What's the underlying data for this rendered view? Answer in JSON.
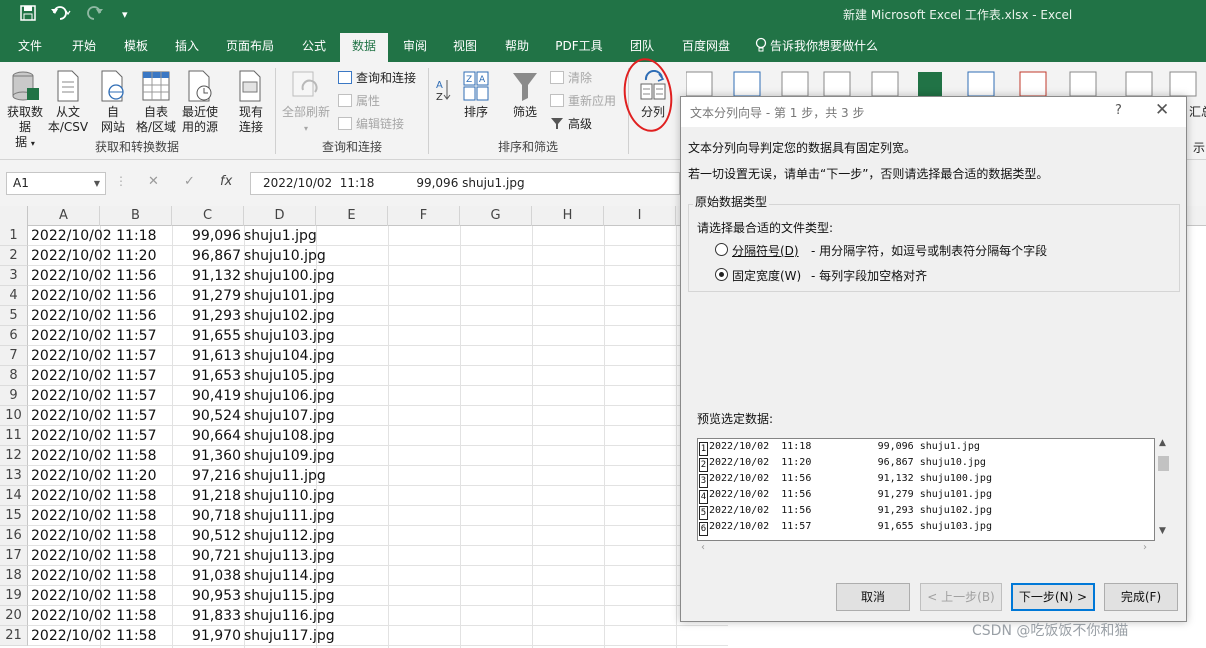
{
  "window": {
    "title": "新建 Microsoft Excel 工作表.xlsx  -  Excel"
  },
  "quick_access": {
    "save_icon": "save-icon",
    "undo_icon": "undo-icon",
    "redo_icon": "redo-icon",
    "customize_glyph": "▾"
  },
  "tabs": [
    "文件",
    "开始",
    "模板",
    "插入",
    "页面布局",
    "公式",
    "数据",
    "审阅",
    "视图",
    "帮助",
    "PDF工具",
    "团队",
    "百度网盘",
    "告诉我你想要做什么"
  ],
  "active_tab": "数据",
  "ribbon": {
    "get_transform": {
      "get_data": "获取数据",
      "get_data_2": "据",
      "from_text": "从文",
      "from_text_2": "本/CSV",
      "from_web": "自",
      "from_web_2": "网站",
      "from_table": "自表",
      "from_table_2": "格/区域",
      "recent": "最近使",
      "recent_2": "用的源",
      "existing": "现有",
      "existing_2": "连接",
      "group_label": "获取和转换数据"
    },
    "queries": {
      "refresh_all": "全部刷新",
      "queries_connections": "查询和连接",
      "properties": "属性",
      "edit_links": "编辑链接",
      "group_label": "查询和连接"
    },
    "sort_filter": {
      "sort": "排序",
      "filter": "筛选",
      "clear": "清除",
      "reapply": "重新应用",
      "advanced": "高级",
      "group_label": "排序和筛选"
    },
    "data_tools": {
      "text_to_columns": "分列"
    },
    "cut_off_right": "汇总",
    "cut_off_right_2": "示"
  },
  "formula_bar": {
    "name_box": "A1",
    "cancel": "✕",
    "enter": "✓",
    "fx": "fx",
    "content": "2022/10/02  11:18           99,096 shuju1.jpg"
  },
  "columns": [
    "A",
    "B",
    "C",
    "D",
    "E",
    "F",
    "G",
    "H",
    "I"
  ],
  "rows": [
    {
      "n": "1",
      "date": "2022/10/02  11:18",
      "size": "99,096",
      "file": "shuju1.jpg"
    },
    {
      "n": "2",
      "date": "2022/10/02  11:20",
      "size": "96,867",
      "file": "shuju10.jpg"
    },
    {
      "n": "3",
      "date": "2022/10/02  11:56",
      "size": "91,132",
      "file": "shuju100.jpg"
    },
    {
      "n": "4",
      "date": "2022/10/02  11:56",
      "size": "91,279",
      "file": "shuju101.jpg"
    },
    {
      "n": "5",
      "date": "2022/10/02  11:56",
      "size": "91,293",
      "file": "shuju102.jpg"
    },
    {
      "n": "6",
      "date": "2022/10/02  11:57",
      "size": "91,655",
      "file": "shuju103.jpg"
    },
    {
      "n": "7",
      "date": "2022/10/02  11:57",
      "size": "91,613",
      "file": "shuju104.jpg"
    },
    {
      "n": "8",
      "date": "2022/10/02  11:57",
      "size": "91,653",
      "file": "shuju105.jpg"
    },
    {
      "n": "9",
      "date": "2022/10/02  11:57",
      "size": "90,419",
      "file": "shuju106.jpg"
    },
    {
      "n": "10",
      "date": "2022/10/02  11:57",
      "size": "90,524",
      "file": "shuju107.jpg"
    },
    {
      "n": "11",
      "date": "2022/10/02  11:57",
      "size": "90,664",
      "file": "shuju108.jpg"
    },
    {
      "n": "12",
      "date": "2022/10/02  11:58",
      "size": "91,360",
      "file": "shuju109.jpg"
    },
    {
      "n": "13",
      "date": "2022/10/02  11:20",
      "size": "97,216",
      "file": "shuju11.jpg"
    },
    {
      "n": "14",
      "date": "2022/10/02  11:58",
      "size": "91,218",
      "file": "shuju110.jpg"
    },
    {
      "n": "15",
      "date": "2022/10/02  11:58",
      "size": "90,718",
      "file": "shuju111.jpg"
    },
    {
      "n": "16",
      "date": "2022/10/02  11:58",
      "size": "90,512",
      "file": "shuju112.jpg"
    },
    {
      "n": "17",
      "date": "2022/10/02  11:58",
      "size": "90,721",
      "file": "shuju113.jpg"
    },
    {
      "n": "18",
      "date": "2022/10/02  11:58",
      "size": "91,038",
      "file": "shuju114.jpg"
    },
    {
      "n": "19",
      "date": "2022/10/02  11:58",
      "size": "90,953",
      "file": "shuju115.jpg"
    },
    {
      "n": "20",
      "date": "2022/10/02  11:58",
      "size": "91,833",
      "file": "shuju116.jpg"
    },
    {
      "n": "21",
      "date": "2022/10/02  11:58",
      "size": "91,970",
      "file": "shuju117.jpg"
    }
  ],
  "dialog": {
    "title": "文本分列向导 - 第 1 步，共 3 步",
    "help": "?",
    "close": "✕",
    "intro1": "文本分列向导判定您的数据具有固定列宽。",
    "intro2": "若一切设置无误，请单击“下一步”，否则请选择最合适的数据类型。",
    "group_title": "原始数据类型",
    "prompt": "请选择最合适的文件类型:",
    "option_delimited": "分隔符号(D)",
    "option_delimited_desc": "- 用分隔字符，如逗号或制表符分隔每个字段",
    "option_fixed": "固定宽度(W)",
    "option_fixed_desc": "- 每列字段加空格对齐",
    "selected_option": "fixed",
    "preview_label": "预览选定数据:",
    "preview_rows": [
      {
        "n": "1",
        "text": "2022/10/02  11:18           99,096 shuju1.jpg"
      },
      {
        "n": "2",
        "text": "2022/10/02  11:20           96,867 shuju10.jpg"
      },
      {
        "n": "3",
        "text": "2022/10/02  11:56           91,132 shuju100.jpg"
      },
      {
        "n": "4",
        "text": "2022/10/02  11:56           91,279 shuju101.jpg"
      },
      {
        "n": "5",
        "text": "2022/10/02  11:56           91,293 shuju102.jpg"
      },
      {
        "n": "6",
        "text": "2022/10/02  11:57           91,655 shuju103.jpg"
      }
    ],
    "buttons": {
      "cancel": "取消",
      "back": "< 上一步(B)",
      "next": "下一步(N) >",
      "finish": "完成(F)"
    }
  },
  "watermark": "CSDN @吃饭饭不你和猫",
  "colors": {
    "excel_green": "#217346",
    "ribbon_bg": "#f3f3f3",
    "annotation_red": "#e02020",
    "dialog_default_border": "#0078d7"
  }
}
